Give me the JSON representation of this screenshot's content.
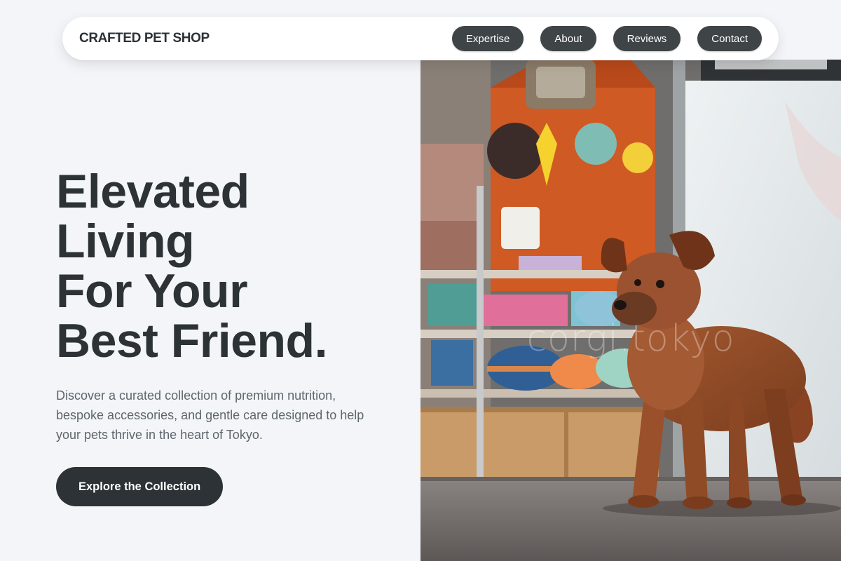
{
  "nav": {
    "brand": "CRAFTED PET SHOP",
    "links": [
      {
        "label": "Expertise"
      },
      {
        "label": "About"
      },
      {
        "label": "Reviews"
      },
      {
        "label": "Contact"
      }
    ]
  },
  "hero": {
    "title_lines": [
      "Elevated",
      "Living",
      "For Your",
      "Best Friend."
    ],
    "description": "Discover a curated collection of premium nutrition, bespoke accessories, and gentle care designed to help your pets thrive in the heart of Tokyo.",
    "cta_label": "Explore the Collection"
  },
  "photo": {
    "watermark": "corgi.tokyo",
    "subject": "small brown dog standing in a pet shop"
  },
  "colors": {
    "page_bg": "#f3f5f8",
    "text_dark": "#2c3236",
    "text_muted": "#5e666c",
    "nav_button": "#3f4447",
    "cta_bg": "#2c3236"
  }
}
